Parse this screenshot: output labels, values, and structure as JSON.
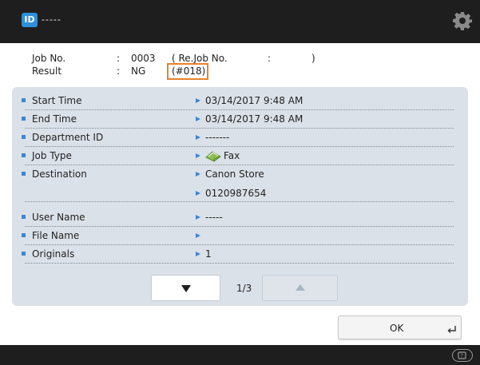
{
  "topbar": {
    "id_badge": "ID",
    "user_name": "-----",
    "settings_icon": "gear-icon"
  },
  "header": {
    "job_no_label": "Job No.",
    "job_no_sep": ":",
    "job_no_value": "0003",
    "re_job_no_open": "( Re.Job No.",
    "re_job_no_sep": ":",
    "re_job_no_close": ")",
    "result_label": "Result",
    "result_sep": ":",
    "result_value": "NG",
    "result_code": "(#018)",
    "result_code_highlight_color": "#e8822d"
  },
  "details": {
    "rows": [
      {
        "label": "Start Time",
        "value": "03/14/2017 9:48 AM"
      },
      {
        "label": "End Time",
        "value": "03/14/2017 9:48 AM"
      },
      {
        "label": "Department ID",
        "value": "-------"
      },
      {
        "label": "Job Type",
        "value": "Fax",
        "icon": "fax-icon"
      },
      {
        "label": "Destination",
        "value": "Canon Store",
        "value2": "0120987654"
      },
      {
        "label": "User Name",
        "value": "-----"
      },
      {
        "label": "File Name",
        "value": ""
      },
      {
        "label": "Originals",
        "value": "1"
      }
    ]
  },
  "pager": {
    "page_text": "1/3",
    "down_icon": "triangle-down-icon",
    "up_icon": "triangle-up-icon"
  },
  "actions": {
    "ok_label": "OK",
    "ok_icon": "enter-icon"
  },
  "footer": {
    "help_icon": "help-icon"
  }
}
